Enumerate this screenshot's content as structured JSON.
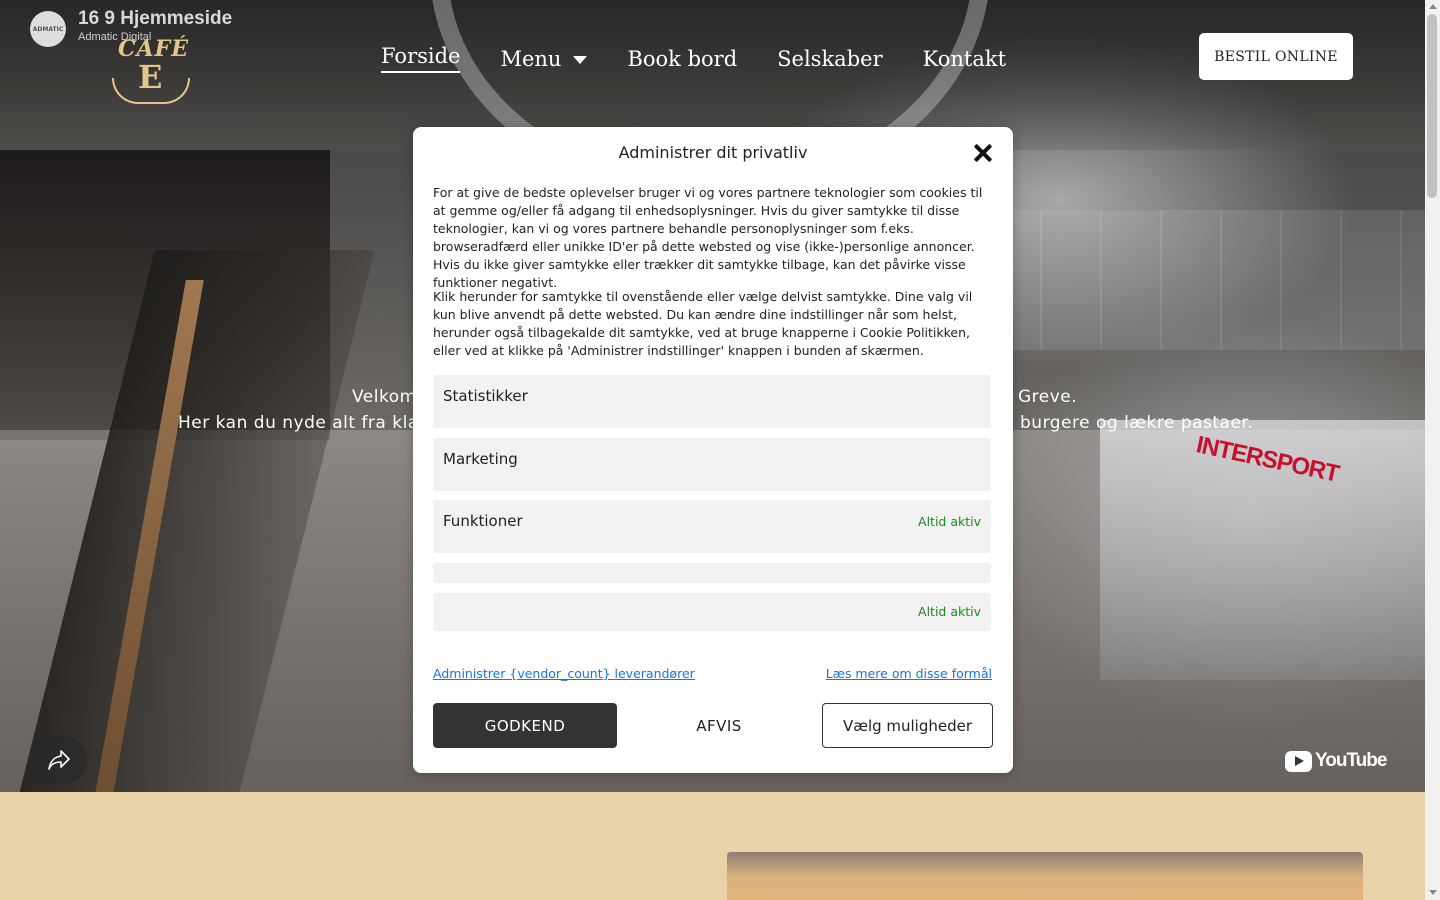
{
  "video": {
    "channel_title": "16 9 Hjemmeside",
    "channel_sub": "Admatic Digital",
    "avatar_text": "ADMATIC",
    "youtube_label": "YouTube",
    "store_sign": "INTERSPORT"
  },
  "logo": {
    "top": "CAFÉ",
    "letter": "E"
  },
  "nav": {
    "items": [
      {
        "label": "Forside",
        "active": true
      },
      {
        "label": "Menu",
        "active": false,
        "dropdown": true
      },
      {
        "label": "Book bord",
        "active": false
      },
      {
        "label": "Selskaber",
        "active": false
      },
      {
        "label": "Kontakt",
        "active": false
      }
    ],
    "order_button": "BESTIL ONLINE"
  },
  "hero": {
    "line1_left": "Velkom",
    "line1_right": "Greve.",
    "line2_left": "Her kan du nyde alt fra klas",
    "line2_right": "burgere og lækre pastaer."
  },
  "consent": {
    "title": "Administrer dit privatliv",
    "paragraph1": "For at give de bedste oplevelser bruger vi og vores partnere teknologier som cookies til at gemme og/eller få adgang til enhedsoplysninger. Hvis du giver samtykke til disse teknologier, kan vi og vores partnere behandle personoplysninger som f.eks. browseradfærd eller unikke ID'er på dette websted og vise (ikke-)personlige annoncer. Hvis du ikke giver samtykke eller trækker dit samtykke tilbage, kan det påvirke visse funktioner negativt.",
    "paragraph2": "Klik herunder for samtykke til ovenstående eller vælge delvist samtykke. Dine valg vil kun blive anvendt på dette websted. Du kan ændre dine indstillinger når som helst, herunder også tilbagekalde dit samtykke, ved at bruge knapperne i Cookie Politikken, eller ved at klikke på 'Administrer indstillinger' knappen i bunden af skærmen.",
    "categories": [
      {
        "name": "Statistikker",
        "status": ""
      },
      {
        "name": "Marketing",
        "status": ""
      },
      {
        "name": "Funktioner",
        "status": "Altid aktiv"
      },
      {
        "name": "",
        "status": ""
      },
      {
        "name": "",
        "status": "Altid aktiv"
      }
    ],
    "link_vendors": "Administrer {vendor_count} leverandører",
    "link_read_more": "Læs mere om disse formål",
    "btn_accept": "GODKEND",
    "btn_deny": "AFVIS",
    "btn_options": "Vælg muligheder"
  }
}
